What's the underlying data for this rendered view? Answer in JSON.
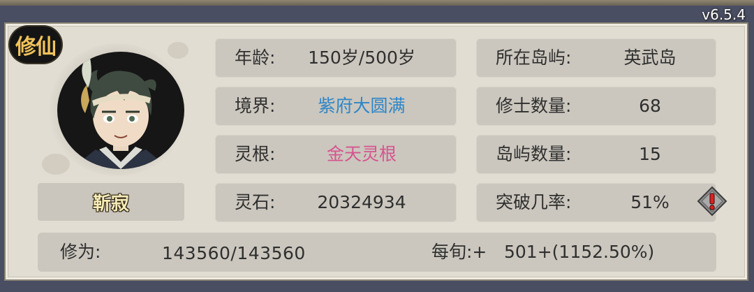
{
  "version": "v6.5.4",
  "badge": {
    "label": "修仙"
  },
  "character": {
    "name": "靳寂"
  },
  "stats_left": [
    {
      "label": "年龄:",
      "value": "150岁/500岁"
    },
    {
      "label": "境界:",
      "value": "紫府大圆满",
      "color": "#2f86c8"
    },
    {
      "label": "灵根:",
      "value": "金天灵根",
      "color": "#d5558f"
    },
    {
      "label": "灵石:",
      "value": "20324934"
    }
  ],
  "stats_right": [
    {
      "label": "所在岛屿:",
      "value": "英武岛"
    },
    {
      "label": "修士数量:",
      "value": "68"
    },
    {
      "label": "岛屿数量:",
      "value": "15"
    },
    {
      "label": "突破几率:",
      "value": "51%"
    }
  ],
  "cultivation": {
    "label": "修为:",
    "value": "143560/143560",
    "rate_label": "每旬:+",
    "rate_value": "501+(1152.50%)"
  },
  "icons": {
    "warning": "warning-diamond-icon"
  }
}
